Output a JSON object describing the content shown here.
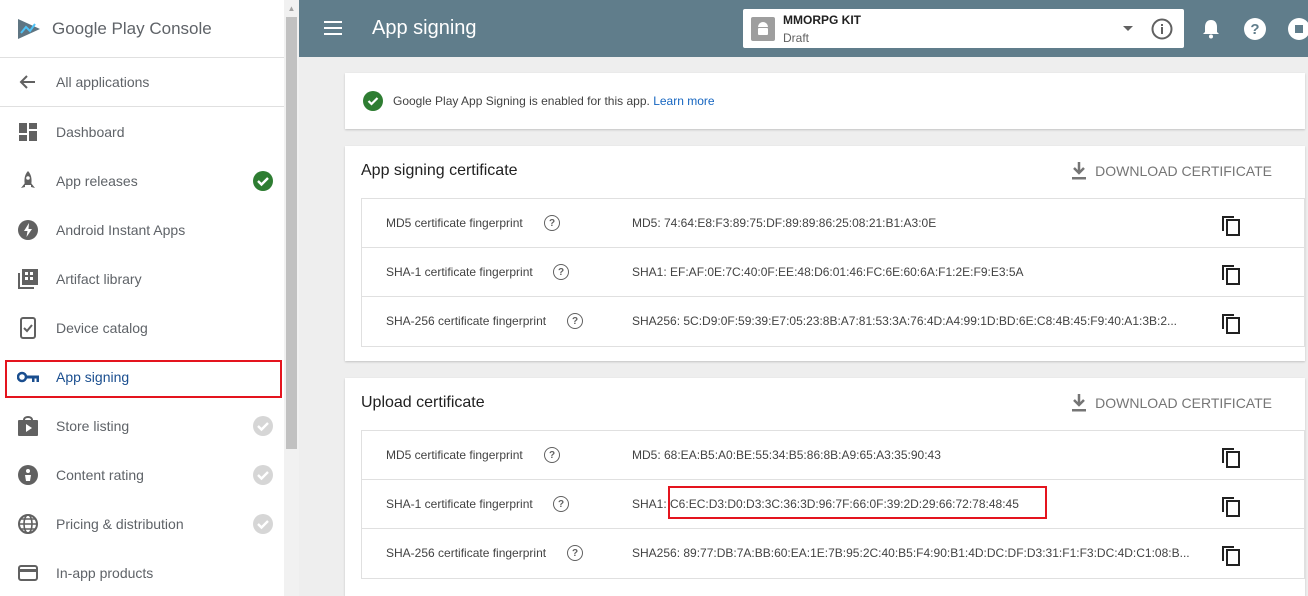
{
  "brand": {
    "name_a": "Google Play",
    "name_b": "Console"
  },
  "sidebar": {
    "items": [
      {
        "label": "All applications",
        "icon": "arrow-back-icon"
      },
      {
        "label": "Dashboard",
        "icon": "dashboard-icon"
      },
      {
        "label": "App releases",
        "icon": "rocket-icon",
        "status": "complete"
      },
      {
        "label": "Android Instant Apps",
        "icon": "lightning-icon"
      },
      {
        "label": "Artifact library",
        "icon": "library-icon"
      },
      {
        "label": "Device catalog",
        "icon": "device-check-icon"
      },
      {
        "label": "App signing",
        "icon": "key-icon",
        "active": true
      },
      {
        "label": "Store listing",
        "icon": "store-icon",
        "status": "pending"
      },
      {
        "label": "Content rating",
        "icon": "rating-icon",
        "status": "pending"
      },
      {
        "label": "Pricing & distribution",
        "icon": "globe-icon",
        "status": "pending"
      },
      {
        "label": "In-app products",
        "icon": "card-icon"
      }
    ]
  },
  "topbar": {
    "title": "App signing",
    "app": {
      "name": "MMORPG KIT",
      "status": "Draft"
    }
  },
  "banner": {
    "text": "Google Play App Signing is enabled for this app.",
    "link": "Learn more"
  },
  "app_signing_certificate": {
    "title": "App signing certificate",
    "download_label": "DOWNLOAD CERTIFICATE",
    "rows": [
      {
        "label": "MD5 certificate fingerprint",
        "value": "MD5: 74:64:E8:F3:89:75:DF:89:89:86:25:08:21:B1:A3:0E"
      },
      {
        "label": "SHA-1 certificate fingerprint",
        "value": "SHA1: EF:AF:0E:7C:40:0F:EE:48:D6:01:46:FC:6E:60:6A:F1:2E:F9:E3:5A"
      },
      {
        "label": "SHA-256 certificate fingerprint",
        "value": "SHA256: 5C:D9:0F:59:39:E7:05:23:8B:A7:81:53:3A:76:4D:A4:99:1D:BD:6E:C8:4B:45:F9:40:A1:3B:2..."
      }
    ]
  },
  "upload_certificate": {
    "title": "Upload certificate",
    "download_label": "DOWNLOAD CERTIFICATE",
    "rows": [
      {
        "label": "MD5 certificate fingerprint",
        "value": "MD5: 68:EA:B5:A0:BE:55:34:B5:86:8B:A9:65:A3:35:90:43"
      },
      {
        "label": "SHA-1 certificate fingerprint",
        "value": "SHA1: C6:EC:D3:D0:D3:3C:36:3D:96:7F:66:0F:39:2D:29:66:72:78:48:45"
      },
      {
        "label": "SHA-256 certificate fingerprint",
        "value": "SHA256: 89:77:DB:7A:BB:60:EA:1E:7B:95:2C:40:B5:F4:90:B1:4D:DC:DF:D3:31:F1:F3:DC:4D:C1:08:B..."
      }
    ]
  },
  "colors": {
    "topbar": "#607d8b",
    "accent": "#1a4e8f",
    "success": "#2e7d32",
    "highlight": "#e4141e"
  }
}
